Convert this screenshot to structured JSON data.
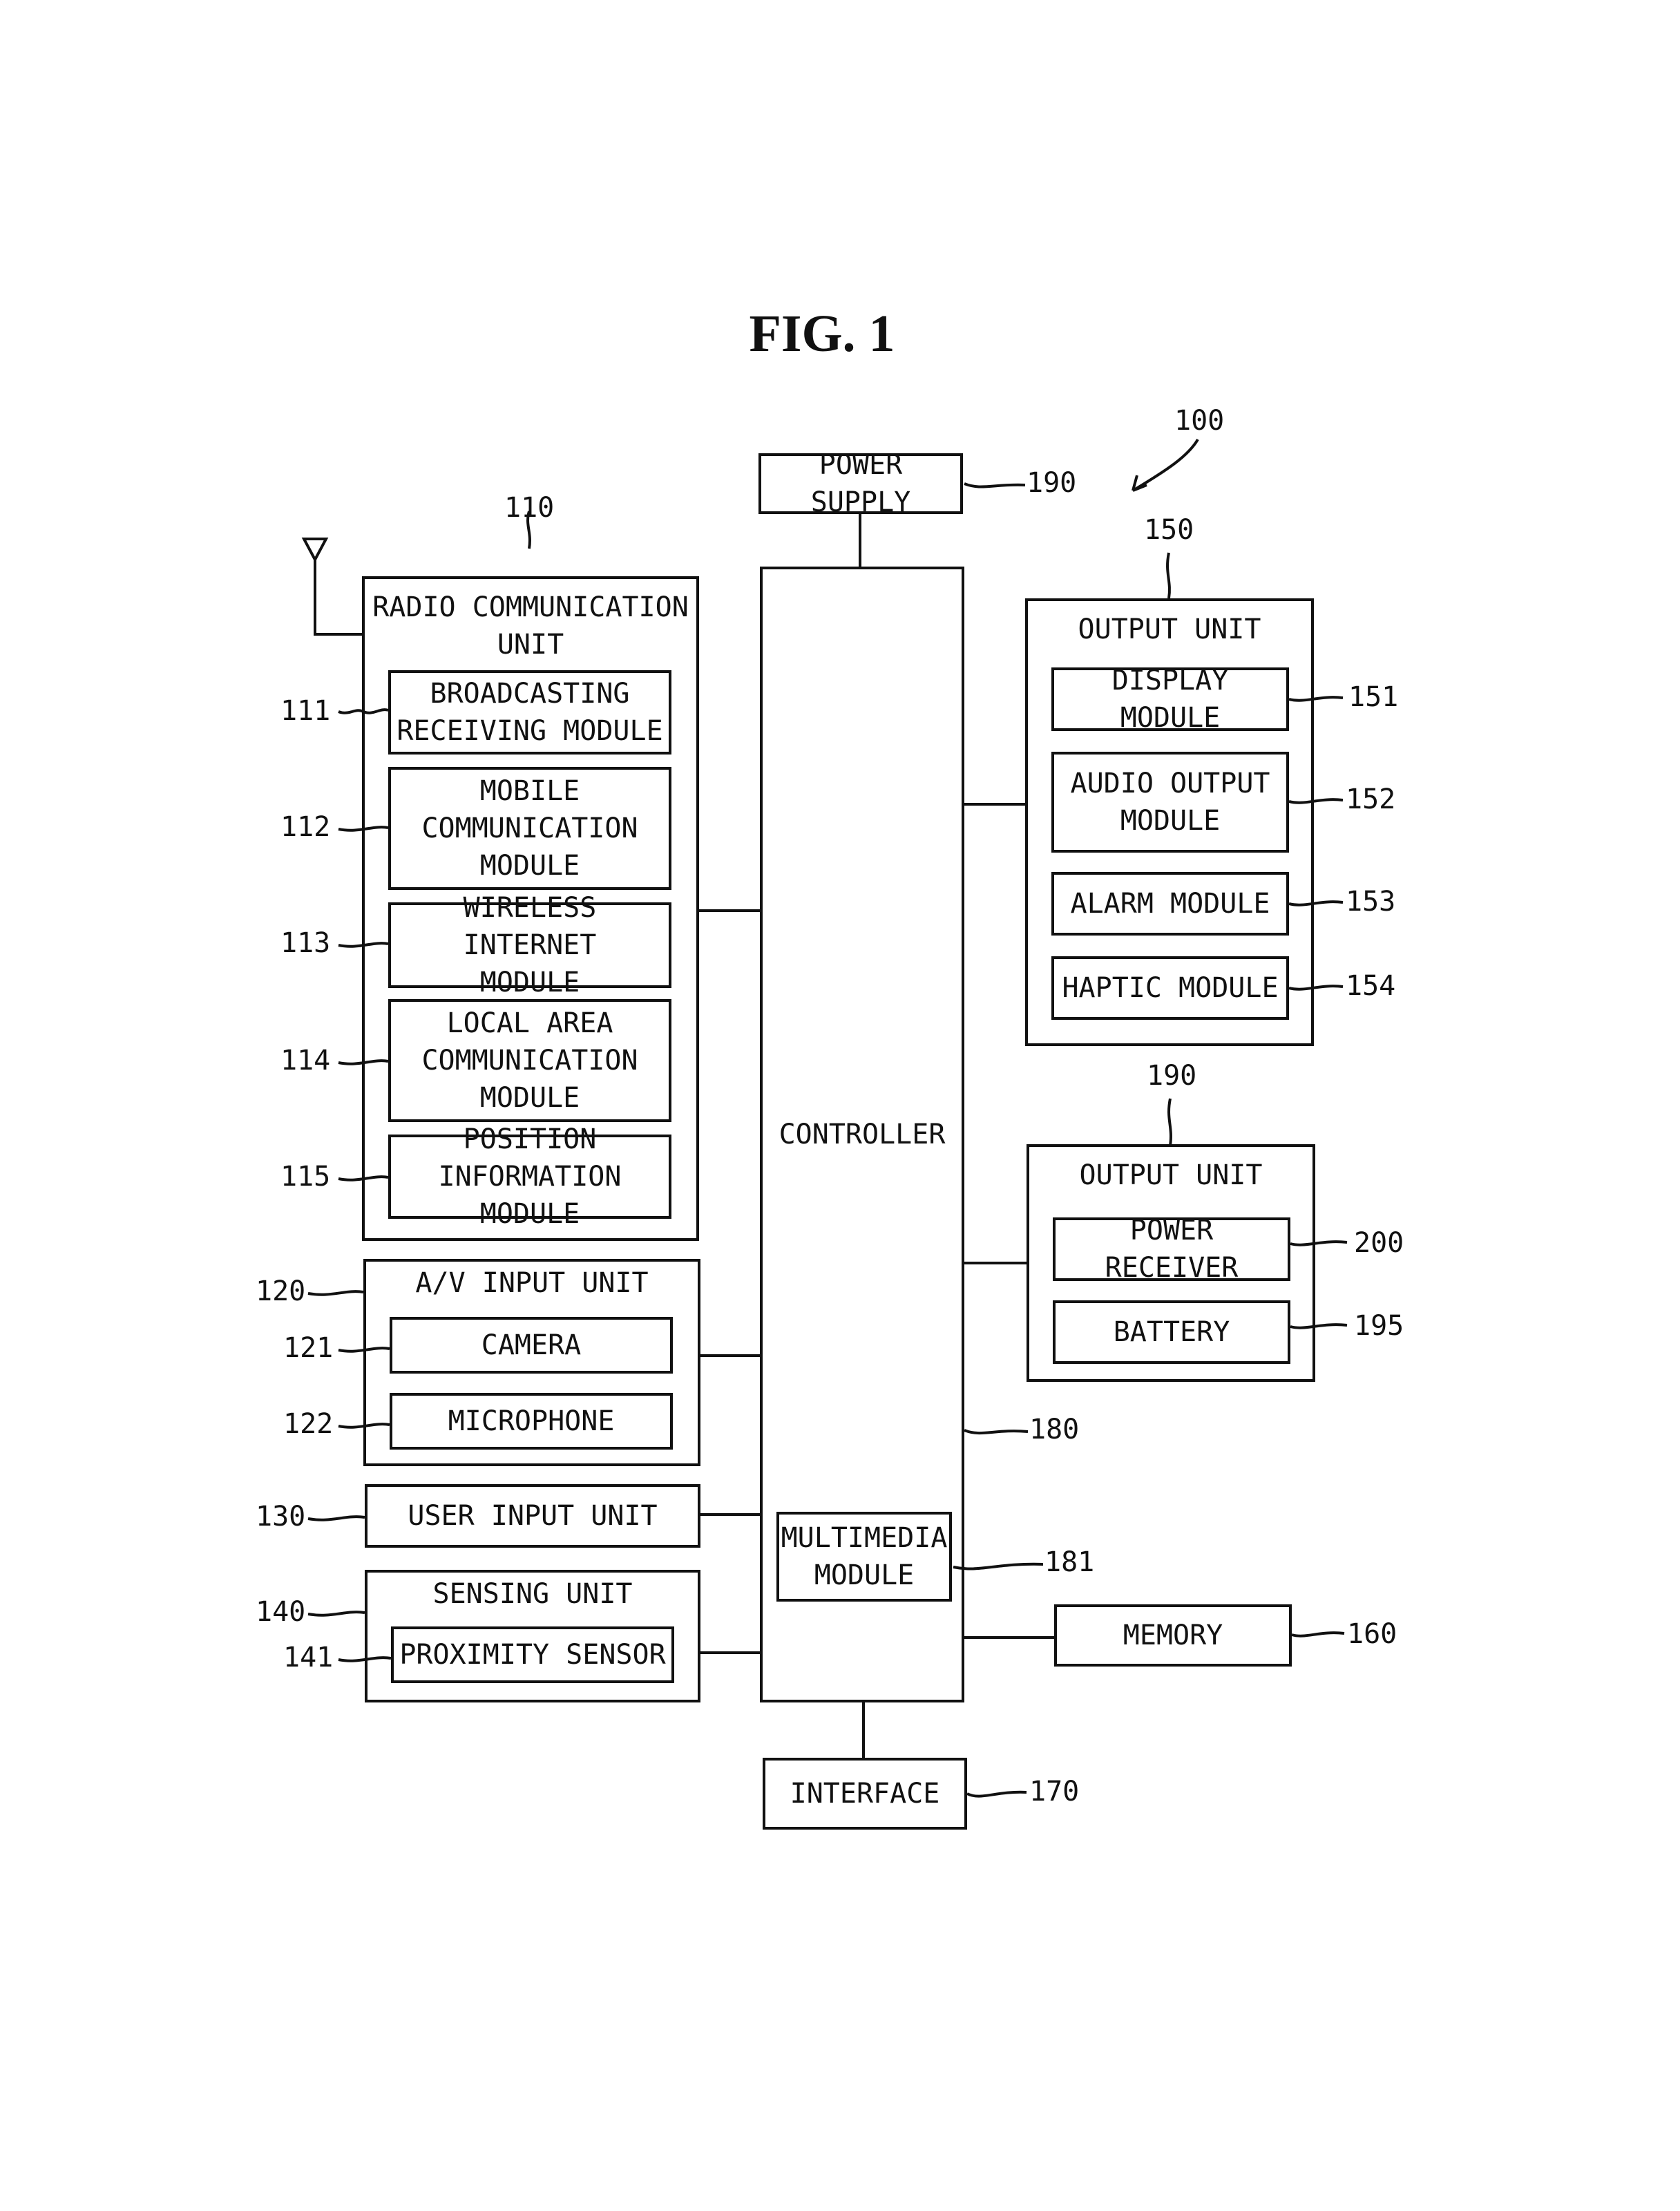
{
  "figure": {
    "title": "FIG. 1",
    "ref": "100"
  },
  "blocks": {
    "power_supply": {
      "label": "POWER SUPPLY",
      "ref": "190"
    },
    "controller": {
      "label": "CONTROLLER",
      "ref": "180"
    },
    "multimedia": {
      "label": "MULTIMEDIA\nMODULE",
      "ref": "181"
    },
    "interface": {
      "label": "INTERFACE",
      "ref": "170"
    },
    "memory": {
      "label": "MEMORY",
      "ref": "160"
    },
    "radio": {
      "label": "RADIO COMMUNICATION\nUNIT",
      "ref": "110",
      "items": [
        {
          "label": "BROADCASTING\nRECEIVING MODULE",
          "ref": "111"
        },
        {
          "label": "MOBILE\nCOMMUNICATION\nMODULE",
          "ref": "112"
        },
        {
          "label": "WIRELESS INTERNET\nMODULE",
          "ref": "113"
        },
        {
          "label": "LOCAL AREA\nCOMMUNICATION\nMODULE",
          "ref": "114"
        },
        {
          "label": "POSITION\nINFORMATION MODULE",
          "ref": "115"
        }
      ]
    },
    "av": {
      "label": "A/V INPUT UNIT",
      "ref": "120",
      "items": [
        {
          "label": "CAMERA",
          "ref": "121"
        },
        {
          "label": "MICROPHONE",
          "ref": "122"
        }
      ]
    },
    "user_input": {
      "label": "USER INPUT UNIT",
      "ref": "130"
    },
    "sensing": {
      "label": "SENSING UNIT",
      "ref": "140",
      "items": [
        {
          "label": "PROXIMITY SENSOR",
          "ref": "141"
        }
      ]
    },
    "output": {
      "label": "OUTPUT UNIT",
      "ref": "150",
      "items": [
        {
          "label": "DISPLAY MODULE",
          "ref": "151"
        },
        {
          "label": "AUDIO OUTPUT\nMODULE",
          "ref": "152"
        },
        {
          "label": "ALARM MODULE",
          "ref": "153"
        },
        {
          "label": "HAPTIC MODULE",
          "ref": "154"
        }
      ]
    },
    "output2": {
      "label": "OUTPUT UNIT",
      "ref": "190",
      "items": [
        {
          "label": "POWER RECEIVER",
          "ref": "200"
        },
        {
          "label": "BATTERY",
          "ref": "195"
        }
      ]
    }
  }
}
